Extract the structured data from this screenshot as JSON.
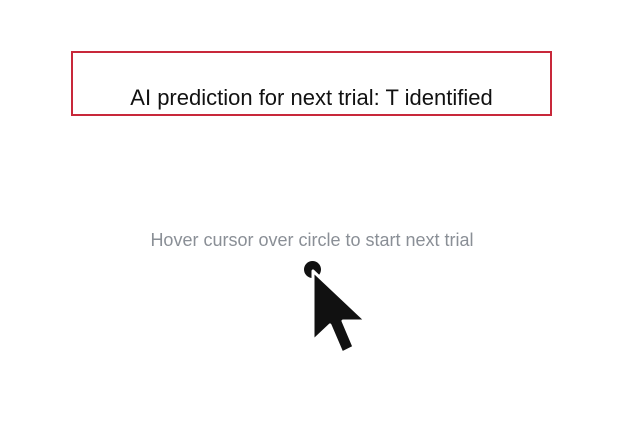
{
  "prediction_banner": {
    "text": "AI prediction for next trial: T identified",
    "border_color": "#c8283a"
  },
  "trial_start": {
    "instruction": "Hover cursor over circle to start next trial",
    "instruction_color": "#8a8f96",
    "target_icon": "filled-circle",
    "target_color": "#111111"
  },
  "cursor": {
    "icon": "arrow-pointer-icon"
  }
}
